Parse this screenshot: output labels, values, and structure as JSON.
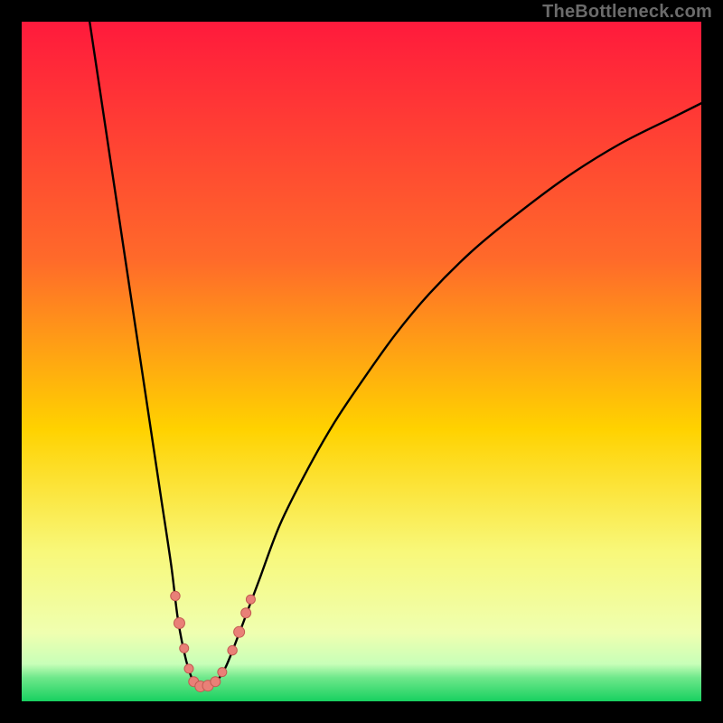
{
  "watermark": "TheBottleneck.com",
  "chart_data": {
    "type": "line",
    "title": "",
    "xlabel": "",
    "ylabel": "",
    "xlim": [
      0,
      100
    ],
    "ylim": [
      0,
      100
    ],
    "gradient_stops": [
      {
        "offset": 0,
        "color": "#ff1a3c"
      },
      {
        "offset": 0.35,
        "color": "#ff6a2a"
      },
      {
        "offset": 0.6,
        "color": "#ffd200"
      },
      {
        "offset": 0.78,
        "color": "#f8f87a"
      },
      {
        "offset": 0.9,
        "color": "#efffb0"
      },
      {
        "offset": 0.945,
        "color": "#c8ffb8"
      },
      {
        "offset": 0.965,
        "color": "#6fe88b"
      },
      {
        "offset": 1.0,
        "color": "#18d060"
      }
    ],
    "series": [
      {
        "name": "bottleneck-curve",
        "stroke": "#000000",
        "x": [
          10.0,
          11.5,
          13.0,
          14.5,
          16.0,
          17.5,
          19.0,
          20.5,
          22.0,
          23.0,
          24.2,
          25.3,
          26.0,
          27.0,
          28.5,
          30.0,
          32.0,
          33.5,
          35.0,
          38.0,
          42.0,
          46.0,
          50.0,
          55.0,
          60.0,
          66.0,
          72.0,
          80.0,
          88.0,
          96.0,
          100.0
        ],
        "y": [
          100.0,
          90.0,
          80.0,
          70.0,
          60.0,
          50.0,
          40.0,
          30.0,
          20.0,
          12.0,
          6.0,
          2.8,
          2.2,
          2.2,
          2.8,
          5.0,
          10.0,
          14.0,
          18.0,
          26.0,
          34.0,
          41.0,
          47.0,
          54.0,
          60.0,
          66.0,
          71.0,
          77.0,
          82.0,
          86.0,
          88.0
        ]
      }
    ],
    "markers": [
      {
        "x": 22.6,
        "y": 15.5,
        "r": 5.2
      },
      {
        "x": 23.2,
        "y": 11.5,
        "r": 6.0
      },
      {
        "x": 23.9,
        "y": 7.8,
        "r": 5.0
      },
      {
        "x": 24.6,
        "y": 4.8,
        "r": 5.0
      },
      {
        "x": 25.3,
        "y": 2.9,
        "r": 5.5
      },
      {
        "x": 26.3,
        "y": 2.2,
        "r": 6.0
      },
      {
        "x": 27.4,
        "y": 2.3,
        "r": 6.0
      },
      {
        "x": 28.5,
        "y": 2.9,
        "r": 5.5
      },
      {
        "x": 29.5,
        "y": 4.3,
        "r": 5.0
      },
      {
        "x": 31.0,
        "y": 7.5,
        "r": 5.2
      },
      {
        "x": 32.0,
        "y": 10.2,
        "r": 6.0
      },
      {
        "x": 33.0,
        "y": 13.0,
        "r": 5.5
      },
      {
        "x": 33.7,
        "y": 15.0,
        "r": 5.0
      }
    ],
    "marker_fill": "#e98077",
    "marker_stroke": "#c25a52"
  }
}
